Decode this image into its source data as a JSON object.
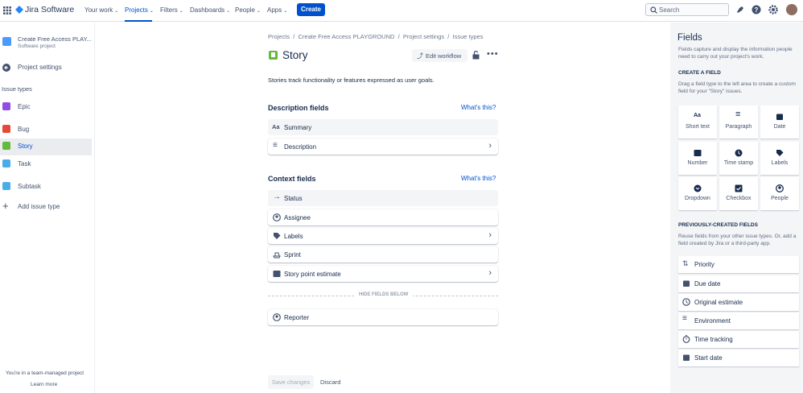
{
  "topnav": {
    "product": "Jira Software",
    "items": [
      {
        "label": "Your work"
      },
      {
        "label": "Projects",
        "active": true
      },
      {
        "label": "Filters"
      },
      {
        "label": "Dashboards"
      },
      {
        "label": "People"
      },
      {
        "label": "Apps"
      }
    ],
    "create": "Create",
    "search_placeholder": "Search"
  },
  "sidebar": {
    "project_name": "Create Free Access PLAY...",
    "project_type": "Software project",
    "back": "Project settings",
    "section": "Issue types",
    "items": [
      {
        "label": "Epic",
        "color": "#904ee2"
      },
      {
        "label": "Bug",
        "color": "#e5493a"
      },
      {
        "label": "Story",
        "color": "#63ba3c",
        "selected": true
      },
      {
        "label": "Task",
        "color": "#4bade8"
      },
      {
        "label": "Subtask",
        "color": "#4bade8"
      }
    ],
    "add": "Add issue type",
    "footer": "You're in a team-managed project",
    "learn_more": "Learn more"
  },
  "main": {
    "breadcrumb": [
      "Projects",
      "Create Free Access PLAYGROUND",
      "Project settings",
      "Issue types"
    ],
    "title": "Story",
    "edit_workflow": "Edit workflow",
    "description": "Stories track functionality or features expressed as user goals.",
    "description_fields": {
      "heading": "Description fields",
      "help": "What's this?",
      "items": [
        {
          "label": "Summary"
        },
        {
          "label": "Description"
        }
      ]
    },
    "context_fields": {
      "heading": "Context fields",
      "help": "What's this?",
      "items": [
        {
          "label": "Status"
        },
        {
          "label": "Assignee"
        },
        {
          "label": "Labels"
        },
        {
          "label": "Sprint"
        },
        {
          "label": "Story point estimate"
        }
      ],
      "divider": "HIDE FIELDS BELOW",
      "hidden": [
        {
          "label": "Reporter"
        }
      ]
    },
    "save": "Save changes",
    "discard": "Discard"
  },
  "fields_panel": {
    "title": "Fields",
    "intro": "Fields capture and display the information people need to carry out your project's work.",
    "create_heading": "CREATE A FIELD",
    "create_help": "Drag a field type to the left area to create a custom field for your \"Story\" issues.",
    "types": [
      {
        "label": "Short text"
      },
      {
        "label": "Paragraph"
      },
      {
        "label": "Date"
      },
      {
        "label": "Number"
      },
      {
        "label": "Time stamp"
      },
      {
        "label": "Labels"
      },
      {
        "label": "Dropdown"
      },
      {
        "label": "Checkbox"
      },
      {
        "label": "People"
      }
    ],
    "prev_heading": "PREVIOUSLY-CREATED FIELDS",
    "prev_help": "Reuse fields from your other issue types. Or, add a field created by Jira or a third-party app.",
    "previous": [
      {
        "label": "Priority"
      },
      {
        "label": "Due date"
      },
      {
        "label": "Original estimate"
      },
      {
        "label": "Environment"
      },
      {
        "label": "Time tracking"
      },
      {
        "label": "Start date"
      }
    ]
  }
}
